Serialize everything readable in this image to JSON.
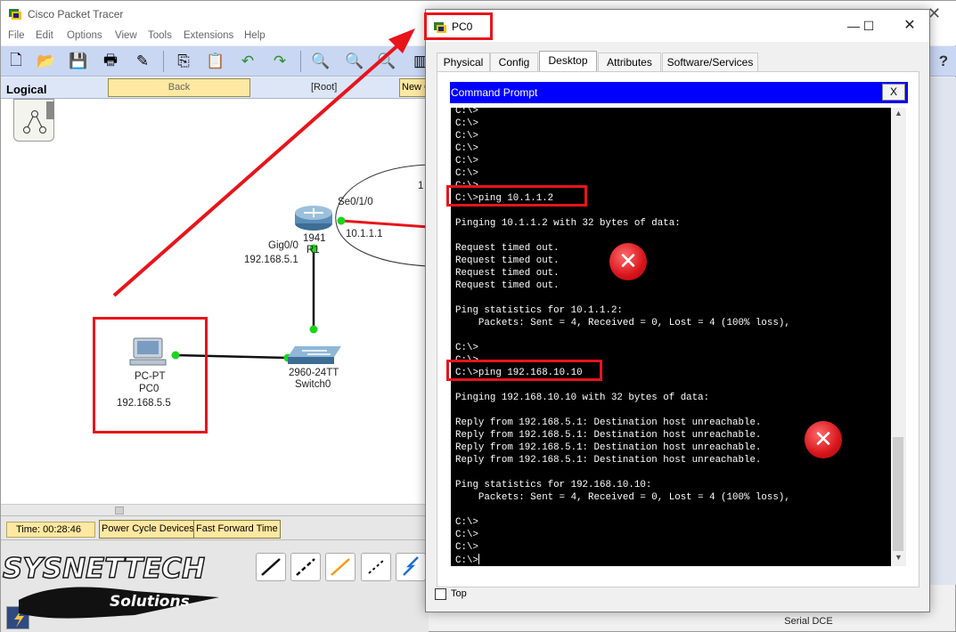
{
  "app": {
    "title": "Cisco Packet Tracer"
  },
  "menu": [
    "File",
    "Edit",
    "Options",
    "View",
    "Tools",
    "Extensions",
    "Help"
  ],
  "workspace": {
    "mode_label": "Logical",
    "back_label": "Back",
    "root_label": "[Root]",
    "new_cluster_label": "New C"
  },
  "topology": {
    "router": {
      "model": "1941",
      "name": "R1",
      "if_serial": "Se0/1/0",
      "ip_serial": "10.1.1.1",
      "if_gig": "Gig0/0",
      "ip_gig": "192.168.5.1",
      "remote_partial": "1"
    },
    "switch": {
      "model": "2960-24TT",
      "name": "Switch0"
    },
    "pc": {
      "type": "PC-PT",
      "name": "PC0",
      "ip": "192.168.5.5"
    }
  },
  "status": {
    "time": "Time: 00:28:46",
    "power_cycle": "Power Cycle Devices",
    "fast_forward": "Fast Forward Time"
  },
  "connection_type": "Serial DCE",
  "watermark": {
    "brand": "SYSNETTECH",
    "sub": "Solutions"
  },
  "dialog": {
    "title": "PC0",
    "tabs": [
      "Physical",
      "Config",
      "Desktop",
      "Attributes",
      "Software/Services"
    ],
    "active_tab": "Desktop",
    "cmd_title": "Command Prompt",
    "cmd_close": "X",
    "top_checkbox": "Top",
    "terminal_lines": [
      "C:\\>",
      "C:\\>",
      "C:\\>",
      "C:\\>",
      "C:\\>",
      "C:\\>",
      "C:\\>",
      "C:\\>ping 10.1.1.2",
      "",
      "Pinging 10.1.1.2 with 32 bytes of data:",
      "",
      "Request timed out.",
      "Request timed out.",
      "Request timed out.",
      "Request timed out.",
      "",
      "Ping statistics for 10.1.1.2:",
      "    Packets: Sent = 4, Received = 0, Lost = 4 (100% loss),",
      "",
      "C:\\>",
      "C:\\>",
      "C:\\>ping 192.168.10.10",
      "",
      "Pinging 192.168.10.10 with 32 bytes of data:",
      "",
      "Reply from 192.168.5.1: Destination host unreachable.",
      "Reply from 192.168.5.1: Destination host unreachable.",
      "Reply from 192.168.5.1: Destination host unreachable.",
      "Reply from 192.168.5.1: Destination host unreachable.",
      "",
      "Ping statistics for 192.168.10.10:",
      "    Packets: Sent = 4, Received = 0, Lost = 4 (100% loss),",
      "",
      "C:\\>",
      "C:\\>",
      "C:\\>",
      "C:\\>"
    ]
  },
  "colors": {
    "annotation_red": "#e8141b",
    "cmd_header_blue": "#0000ff",
    "link_green": "#1bd51b",
    "toolbar_blue": "#c9d7f3",
    "status_yellow": "#ffe8a1"
  }
}
